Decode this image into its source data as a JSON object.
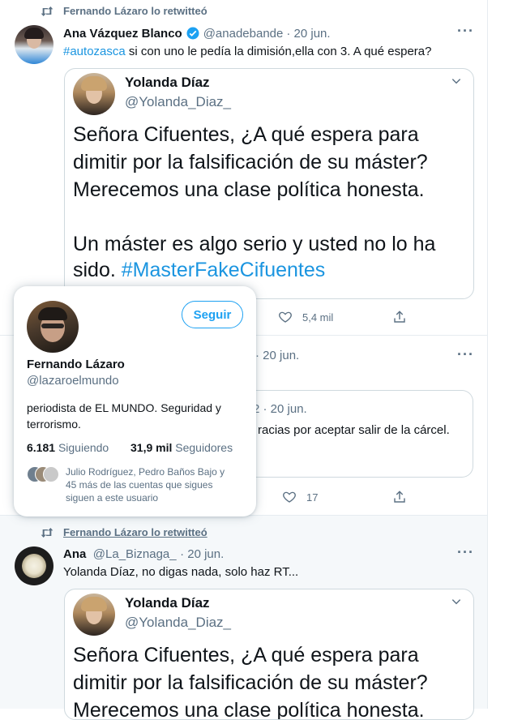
{
  "tweets": [
    {
      "retweet_label": "Fernando Lázaro lo retwitteó",
      "author": "Ana Vázquez Blanco",
      "handle": "@anadebande",
      "date": "· 20 jun.",
      "hashtag": "#autozasca",
      "text": " si con uno le pedía la dimisión,ella con 3. A qué espera?",
      "quote": {
        "author": "Yolanda Díaz",
        "handle": "@Yolanda_Diaz_",
        "lines": [
          "Señora Cifuentes, ¿A qué espera para",
          "dimitir por la falsificación de su máster?",
          "Merecemos una clase política honesta.",
          "",
          "Un máster es algo serio y usted no lo ha"
        ],
        "last_line_prefix": "sido. ",
        "last_line_hashtag": "#MasterFakeCifuentes"
      },
      "likes": "5,4 mil"
    },
    {
      "date": "· 20 jun.",
      "quote_date_fragment": "2 · 20 jun.",
      "quote_text_fragment": "racias por aceptar salir de la cárcel.",
      "likes": "17"
    },
    {
      "retweet_label": "Fernando Lázaro lo retwitteó",
      "author": "Ana",
      "handle": "@La_Biznaga_",
      "date": "· 20 jun.",
      "text": "Yolanda Díaz, no digas nada, solo haz RT...",
      "quote": {
        "author": "Yolanda Díaz",
        "handle": "@Yolanda_Diaz_",
        "lines": [
          "Señora Cifuentes, ¿A qué espera para",
          "dimitir por la falsificación de su máster?",
          "Merecemos una clase política honesta."
        ]
      }
    }
  ],
  "hovercard": {
    "follow_label": "Seguir",
    "name": "Fernando Lázaro",
    "handle": "@lazaroelmundo",
    "bio_line1": "periodista de EL MUNDO. Seguridad y",
    "bio_line2": "terrorismo.",
    "following_count": "6.181",
    "following_label": "Siguiendo",
    "followers_count": "31,9 mil",
    "followers_label": "Seguidores",
    "mutuals_line1": "Julio Rodríguez, Pedro Baños Bajo y",
    "mutuals_line2": "45 más de las cuentas que sigues",
    "mutuals_line3": "siguen a este usuario"
  },
  "more_icon": "···",
  "colors": {
    "accent": "#1da1f2",
    "hashtag": "#1b95e0",
    "muted": "#5b7083"
  }
}
